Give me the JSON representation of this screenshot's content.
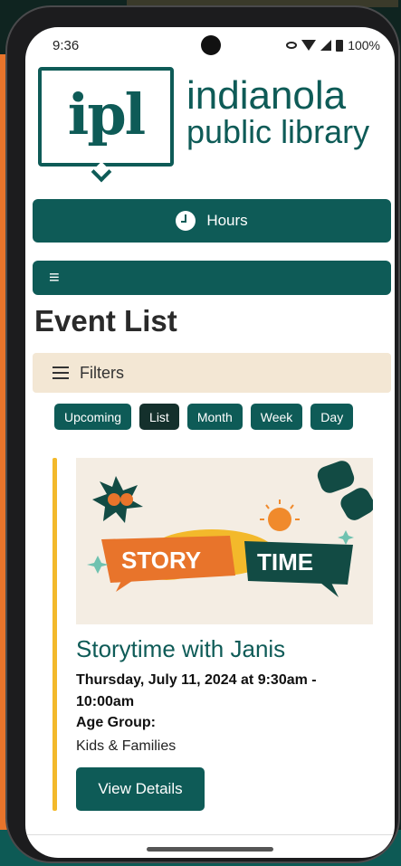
{
  "status_bar": {
    "time": "9:36",
    "battery": "100%"
  },
  "logo": {
    "mark": "ipl",
    "line1": "indianola",
    "line2": "public library"
  },
  "header": {
    "hours_label": "Hours",
    "menu_icon": "≡"
  },
  "page": {
    "title": "Event List"
  },
  "filters": {
    "label": "Filters"
  },
  "view_tabs": [
    "Upcoming",
    "List",
    "Month",
    "Week",
    "Day"
  ],
  "event": {
    "image_text_1": "STORY",
    "image_text_2": "TIME",
    "title": "Storytime with Janis",
    "date": "Thursday, July 11, 2024 at 9:30am - 10:00am",
    "age_group_label": "Age Group:",
    "age_group_value": "Kids & Families",
    "button_label": "View Details"
  },
  "colors": {
    "brand": "#0e5b57",
    "accent": "#f3b92b",
    "filters_bg": "#f3e7d4"
  }
}
